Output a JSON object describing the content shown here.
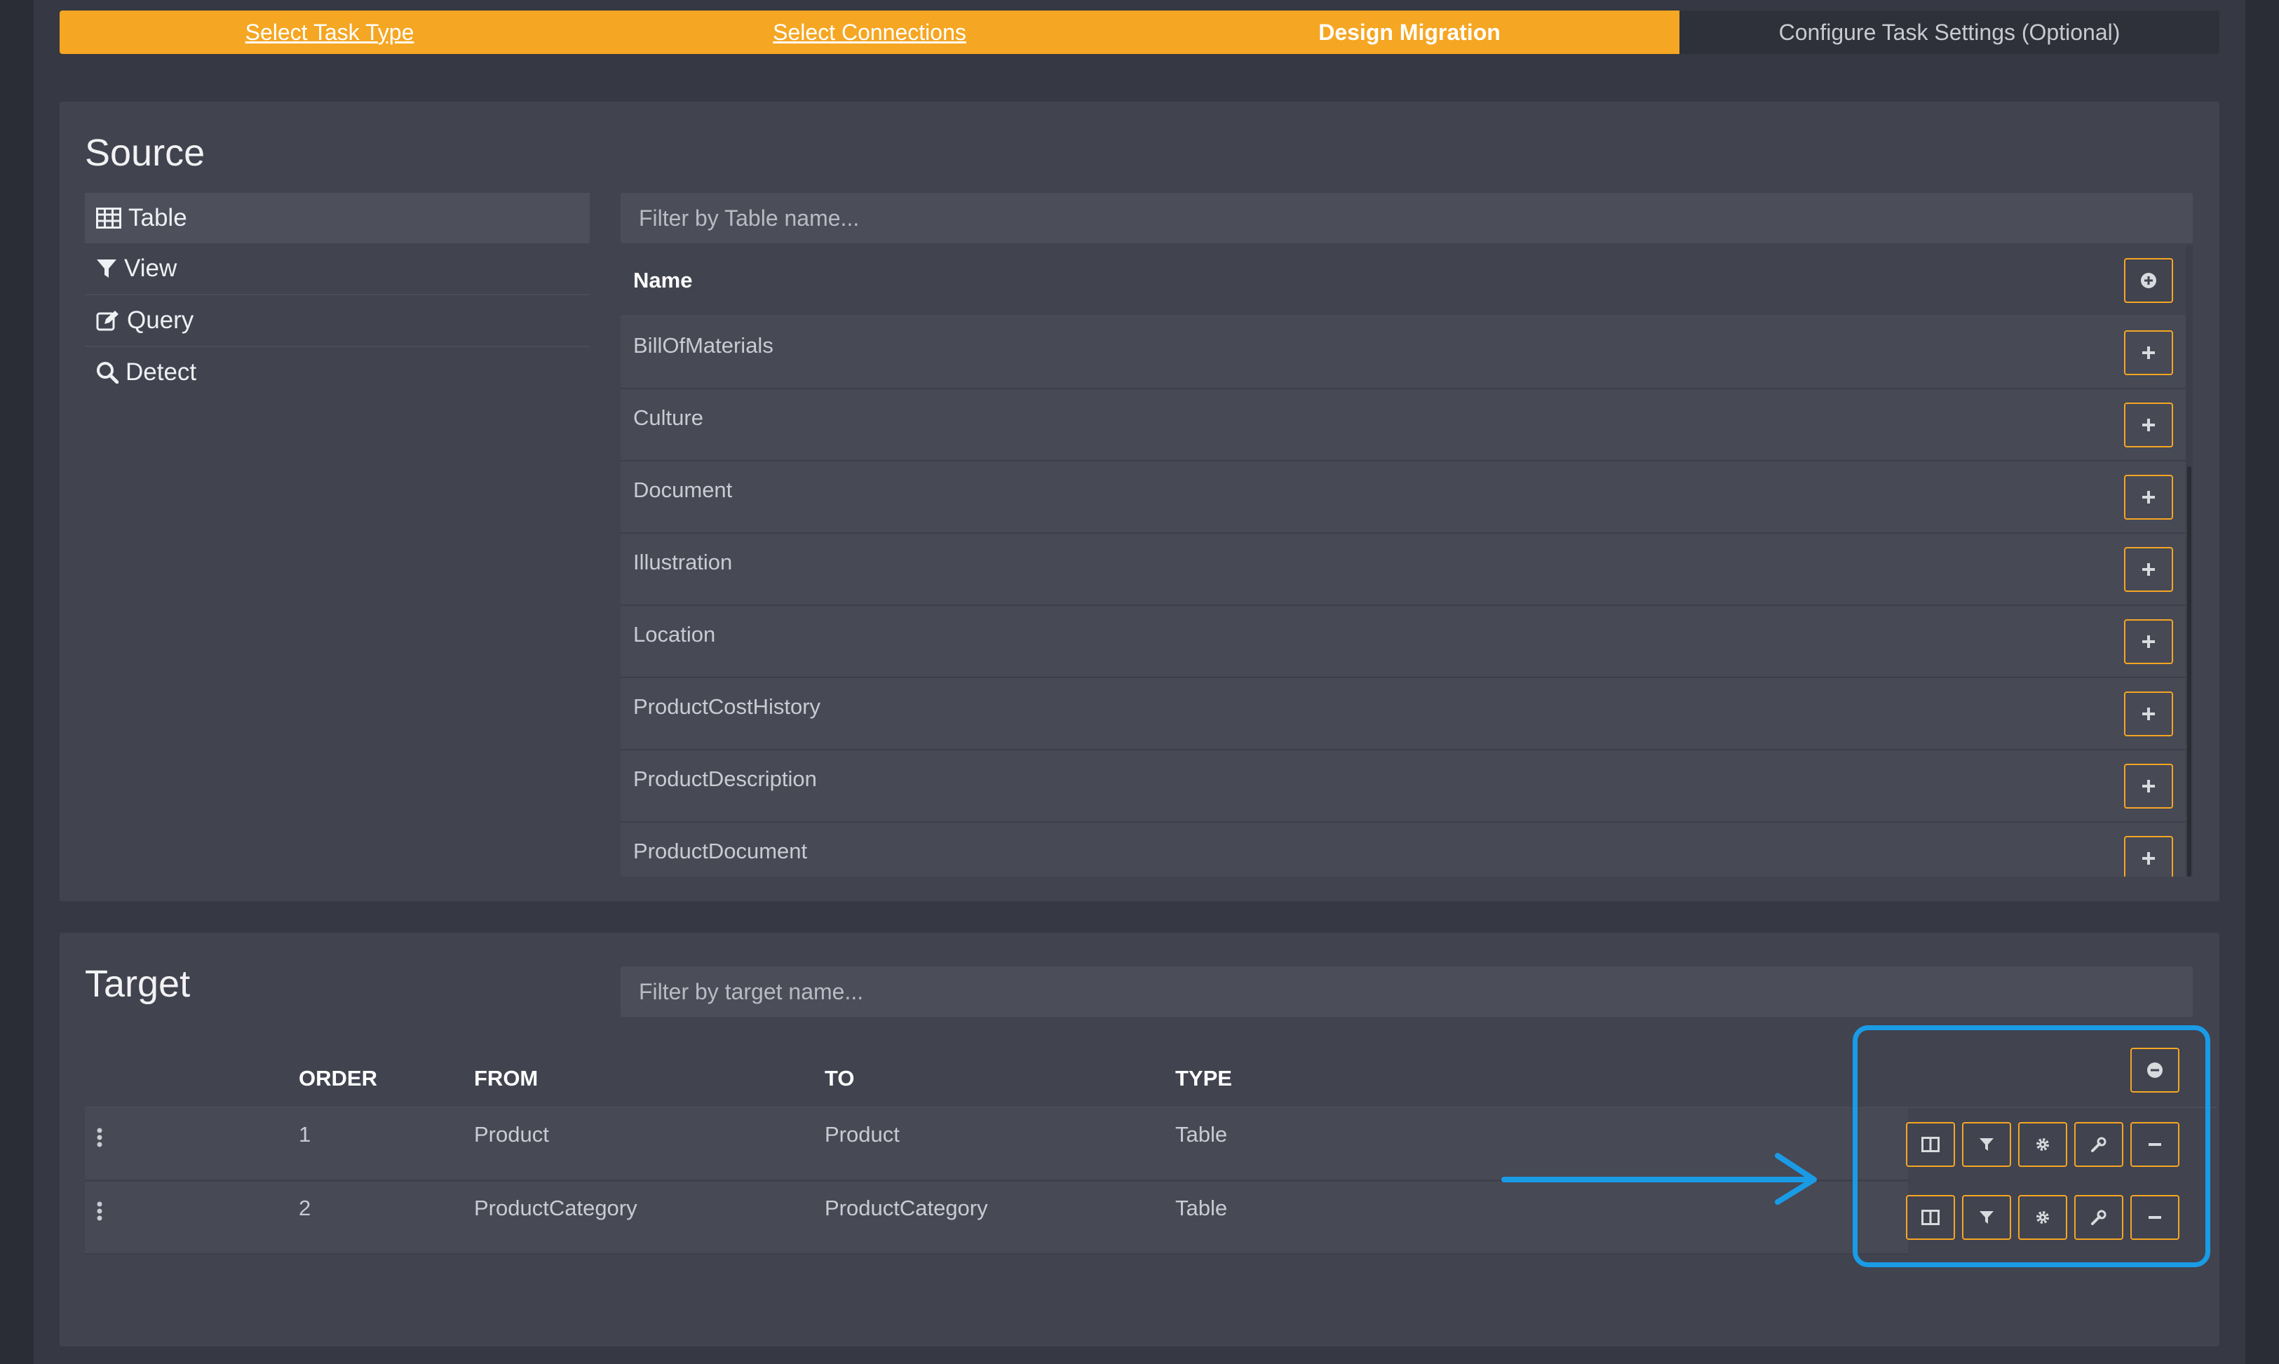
{
  "steps": [
    {
      "label": "Select Task Type",
      "state": "done"
    },
    {
      "label": "Select Connections",
      "state": "done"
    },
    {
      "label": "Design Migration",
      "state": "active"
    },
    {
      "label": "Configure Task Settings (Optional)",
      "state": "pending"
    }
  ],
  "source": {
    "title": "Source",
    "types": [
      {
        "label": "Table",
        "icon": "table-icon"
      },
      {
        "label": "View",
        "icon": "filter-icon"
      },
      {
        "label": "Query",
        "icon": "edit-icon"
      },
      {
        "label": "Detect",
        "icon": "search-icon"
      }
    ],
    "filter_placeholder": "Filter by Table name...",
    "column_name": "Name",
    "tables": [
      "BillOfMaterials",
      "Culture",
      "Document",
      "Illustration",
      "Location",
      "ProductCostHistory",
      "ProductDescription",
      "ProductDocument"
    ]
  },
  "target": {
    "title": "Target",
    "filter_placeholder": "Filter by target name...",
    "columns": {
      "order": "ORDER",
      "from": "FROM",
      "to": "TO",
      "type": "TYPE"
    },
    "rows": [
      {
        "order": "1",
        "from": "Product",
        "to": "Product",
        "type": "Table"
      },
      {
        "order": "2",
        "from": "ProductCategory",
        "to": "ProductCategory",
        "type": "Table"
      }
    ]
  },
  "colors": {
    "accent": "#f5a623",
    "highlight": "#1a9be6",
    "panel": "#41434f"
  }
}
